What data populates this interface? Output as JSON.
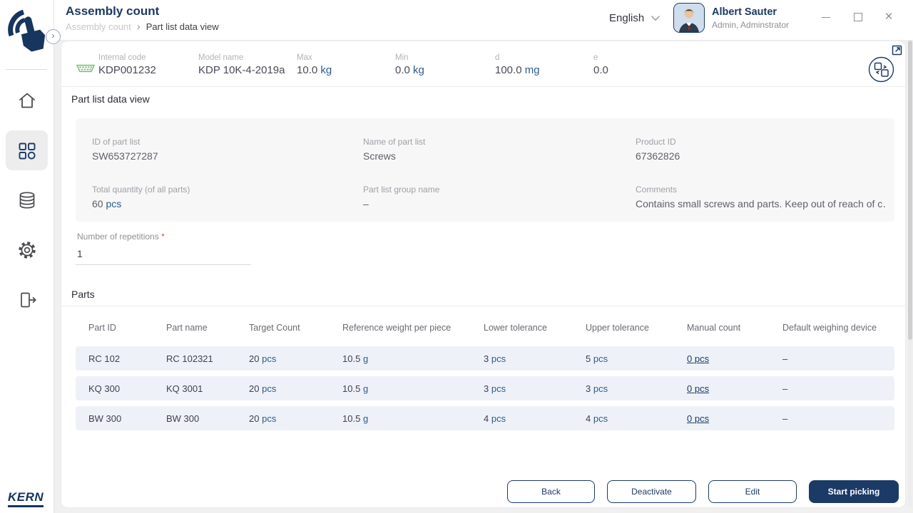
{
  "header": {
    "title": "Assembly count",
    "breadcrumb": {
      "parent": "Assembly count",
      "separator": "›",
      "current": "Part list data view"
    },
    "language_selector": {
      "value": "English"
    },
    "user": {
      "name": "Albert Sauter",
      "role": "Admin, Adminstrator"
    }
  },
  "device_bar": {
    "internal_code": {
      "label": "Internal code",
      "value": "KDP001232"
    },
    "model_name": {
      "label": "Model name",
      "value": "KDP 10K-4-2019a"
    },
    "max": {
      "label": "Max",
      "value": "10.0",
      "unit": "kg"
    },
    "min": {
      "label": "Min",
      "value": "0.0",
      "unit": "kg"
    },
    "d": {
      "label": "d",
      "value": "100.0",
      "unit": "mg"
    },
    "e": {
      "label": "e",
      "value": "0.0"
    }
  },
  "part_list": {
    "section_title": "Part list data view",
    "id": {
      "label": "ID of part list",
      "value": "SW653727287"
    },
    "name": {
      "label": "Name of part list",
      "value": "Screws"
    },
    "product_id": {
      "label": "Product ID",
      "value": "67362826"
    },
    "total_quantity": {
      "label": "Total quantity (of all parts)",
      "value": "60",
      "unit": "pcs"
    },
    "group_name": {
      "label": "Part list group name",
      "value": "–"
    },
    "comments": {
      "label": "Comments",
      "value": "Contains small screws and parts. Keep out of reach of c…"
    },
    "repetitions": {
      "label": "Number of repetitions",
      "required_mark": "*",
      "value": "1"
    }
  },
  "parts_table": {
    "section_title": "Parts",
    "columns": [
      "Part ID",
      "Part name",
      "Target Count",
      "Reference weight per piece",
      "Lower tolerance",
      "Upper tolerance",
      "Manual count",
      "Default weighing device"
    ],
    "rows": [
      {
        "part_id": "RC 102",
        "part_name": "RC 102321",
        "target": "20",
        "target_unit": "pcs",
        "ref": "10.5",
        "ref_unit": "g",
        "lower": "3",
        "lower_unit": "pcs",
        "upper": "5",
        "upper_unit": "pcs",
        "manual": "0",
        "manual_unit": "pcs",
        "device": "–"
      },
      {
        "part_id": "KQ 300",
        "part_name": "KQ 3001",
        "target": "20",
        "target_unit": "pcs",
        "ref": "10.5",
        "ref_unit": "g",
        "lower": "3",
        "lower_unit": "pcs",
        "upper": "3",
        "upper_unit": "pcs",
        "manual": "0",
        "manual_unit": "pcs",
        "device": "–"
      },
      {
        "part_id": "BW 300",
        "part_name": "BW 300",
        "target": "20",
        "target_unit": "pcs",
        "ref": "10.5",
        "ref_unit": "g",
        "lower": "4",
        "lower_unit": "pcs",
        "upper": "4",
        "upper_unit": "pcs",
        "manual": "0",
        "manual_unit": "pcs",
        "device": "–"
      }
    ]
  },
  "actions": {
    "back": "Back",
    "deactivate": "Deactivate",
    "edit": "Edit",
    "start_picking": "Start picking"
  },
  "brand": {
    "name": "KERN"
  }
}
